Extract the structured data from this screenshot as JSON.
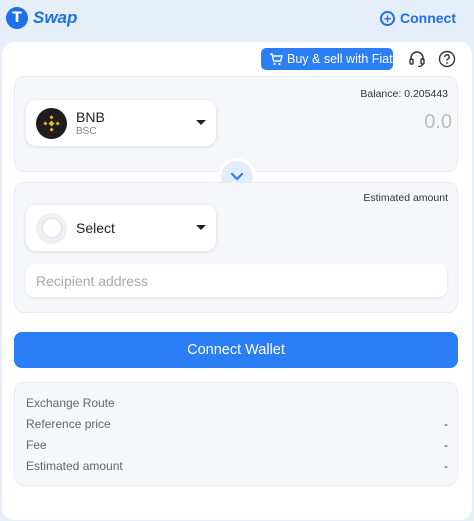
{
  "header": {
    "brand": "Swap",
    "connect_label": "Connect"
  },
  "toolbar": {
    "fiat_label": "Buy & sell with Fiat"
  },
  "from": {
    "balance": "Balance: 0.205443",
    "token_symbol": "BNB",
    "token_chain": "BSC",
    "amount": "0.0"
  },
  "to": {
    "estimated_label": "Estimated amount",
    "token_placeholder": "Select"
  },
  "recipient": {
    "placeholder": "Recipient address"
  },
  "connect_wallet_label": "Connect Wallet",
  "info": {
    "title": "Exchange Route",
    "rows": [
      {
        "label": "Reference price",
        "value": "-"
      },
      {
        "label": "Fee",
        "value": "-"
      },
      {
        "label": "Estimated amount",
        "value": "-"
      }
    ]
  },
  "colors": {
    "accent": "#2b7ef5",
    "brand": "#1e6fe8",
    "bnb": "#f0b90b"
  }
}
